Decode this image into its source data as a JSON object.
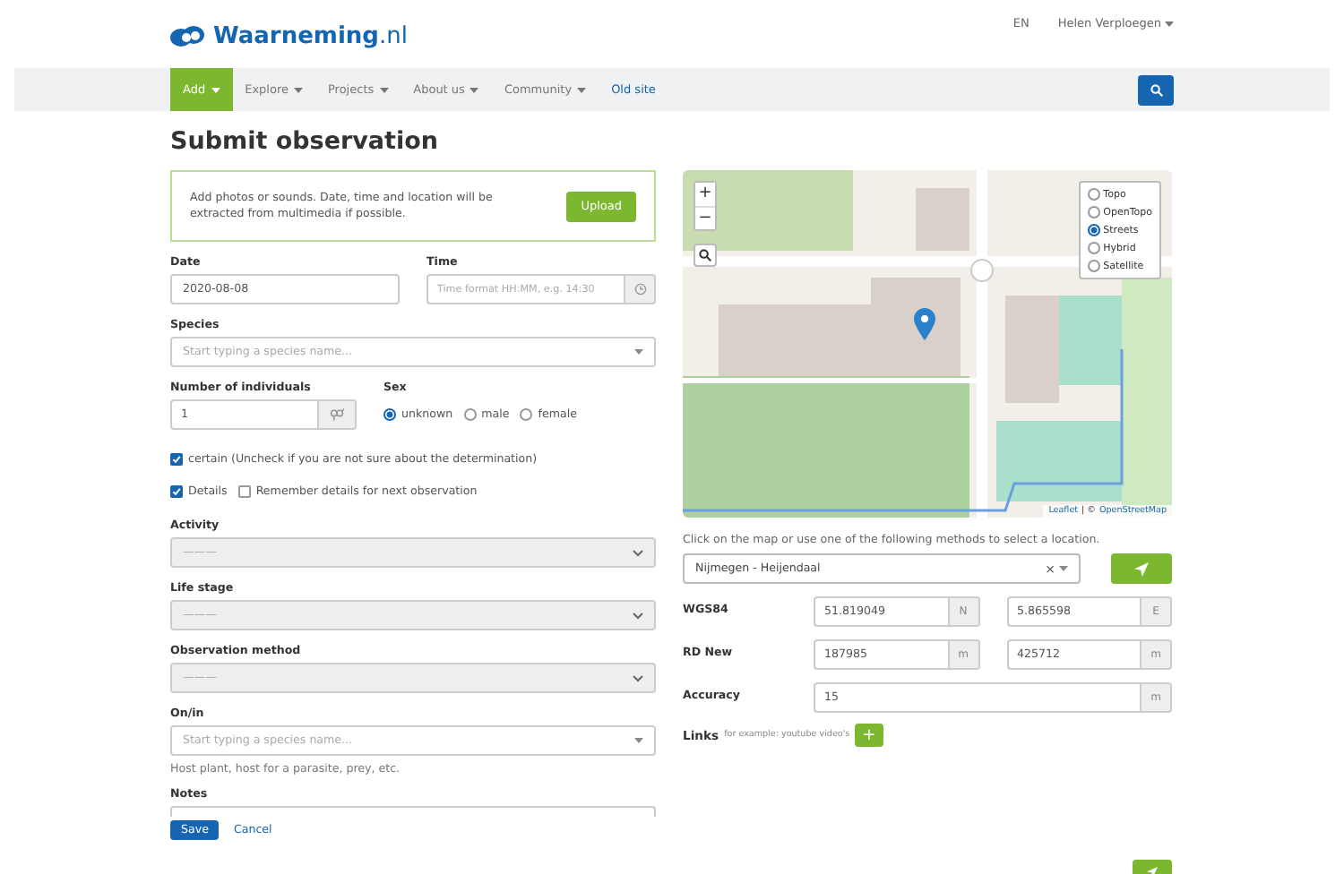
{
  "header": {
    "logo": {
      "name": "Waarneming",
      "suffix": ".nl"
    },
    "language": "EN",
    "user": {
      "name": "Helen Verploegen",
      "dropdown": true
    }
  },
  "nav": {
    "items": [
      {
        "label": "Add",
        "dropdown": true,
        "selected": true,
        "kind": "menu"
      },
      {
        "label": "Explore",
        "dropdown": true,
        "selected": false,
        "kind": "menu"
      },
      {
        "label": "Projects",
        "dropdown": true,
        "selected": false,
        "kind": "menu"
      },
      {
        "label": "About us",
        "dropdown": true,
        "selected": false,
        "kind": "menu"
      },
      {
        "label": "Community",
        "dropdown": true,
        "selected": false,
        "kind": "menu"
      },
      {
        "label": "Old site",
        "dropdown": false,
        "selected": false,
        "kind": "link"
      }
    ]
  },
  "title": "Submit observation",
  "upload": {
    "text": "Add photos or sounds. Date, time and location will be extracted from multimedia if possible.",
    "button": "Upload"
  },
  "date": {
    "label": "Date",
    "value": "2020-08-08"
  },
  "time": {
    "label": "Time",
    "placeholder": "Time format HH:MM, e.g. 14:30"
  },
  "species": {
    "label": "Species",
    "placeholder": "Start typing a species name..."
  },
  "individuals": {
    "label": "Number of individuals",
    "value": "1"
  },
  "sex": {
    "label": "Sex",
    "options": [
      {
        "label": "unknown",
        "selected": true
      },
      {
        "label": "male",
        "selected": false
      },
      {
        "label": "female",
        "selected": false
      }
    ]
  },
  "certain": {
    "label": "certain (Uncheck if you are not sure about the determination)",
    "checked": true
  },
  "detail_checks": [
    {
      "label": "Details",
      "checked": true
    },
    {
      "label": "Remember details for next observation",
      "checked": false
    }
  ],
  "selects": [
    {
      "label": "Activity",
      "placeholder": "———"
    },
    {
      "label": "Life stage",
      "placeholder": "———"
    },
    {
      "label": "Observation method",
      "placeholder": "———"
    }
  ],
  "on_in": {
    "label": "On/in",
    "placeholder": "Start typing a species name...",
    "help": "Host plant, host for a parasite, prey, etc."
  },
  "notes": {
    "label": "Notes"
  },
  "actions": {
    "save": "Save",
    "cancel": "Cancel"
  },
  "map": {
    "zoom_in": "+",
    "zoom_out": "−",
    "layers": [
      {
        "label": "Topo",
        "selected": false
      },
      {
        "label": "OpenTopo",
        "selected": false
      },
      {
        "label": "Streets",
        "selected": true
      },
      {
        "label": "Hybrid",
        "selected": false
      },
      {
        "label": "Satellite",
        "selected": false
      }
    ],
    "attribution": {
      "leaflet": "Leaflet",
      "separator": "| ©",
      "osm": "OpenStreetMap"
    }
  },
  "map_hint": "Click on the map or use one of the following methods to select a location.",
  "location": {
    "value": "Nijmegen - Heijendaal",
    "clear": "×"
  },
  "coordinates": [
    {
      "label": "WGS84",
      "fields": [
        {
          "value": "51.819049",
          "unit": "N"
        },
        {
          "value": "5.865598",
          "unit": "E"
        }
      ]
    },
    {
      "label": "RD New",
      "fields": [
        {
          "value": "187985",
          "unit": "m"
        },
        {
          "value": "425712",
          "unit": "m"
        }
      ]
    },
    {
      "label": "Accuracy",
      "fields": [
        {
          "value": "15",
          "unit": "m"
        }
      ]
    }
  ],
  "links": {
    "label": "Links",
    "hint": "for example: youtube video's",
    "add": "+"
  }
}
